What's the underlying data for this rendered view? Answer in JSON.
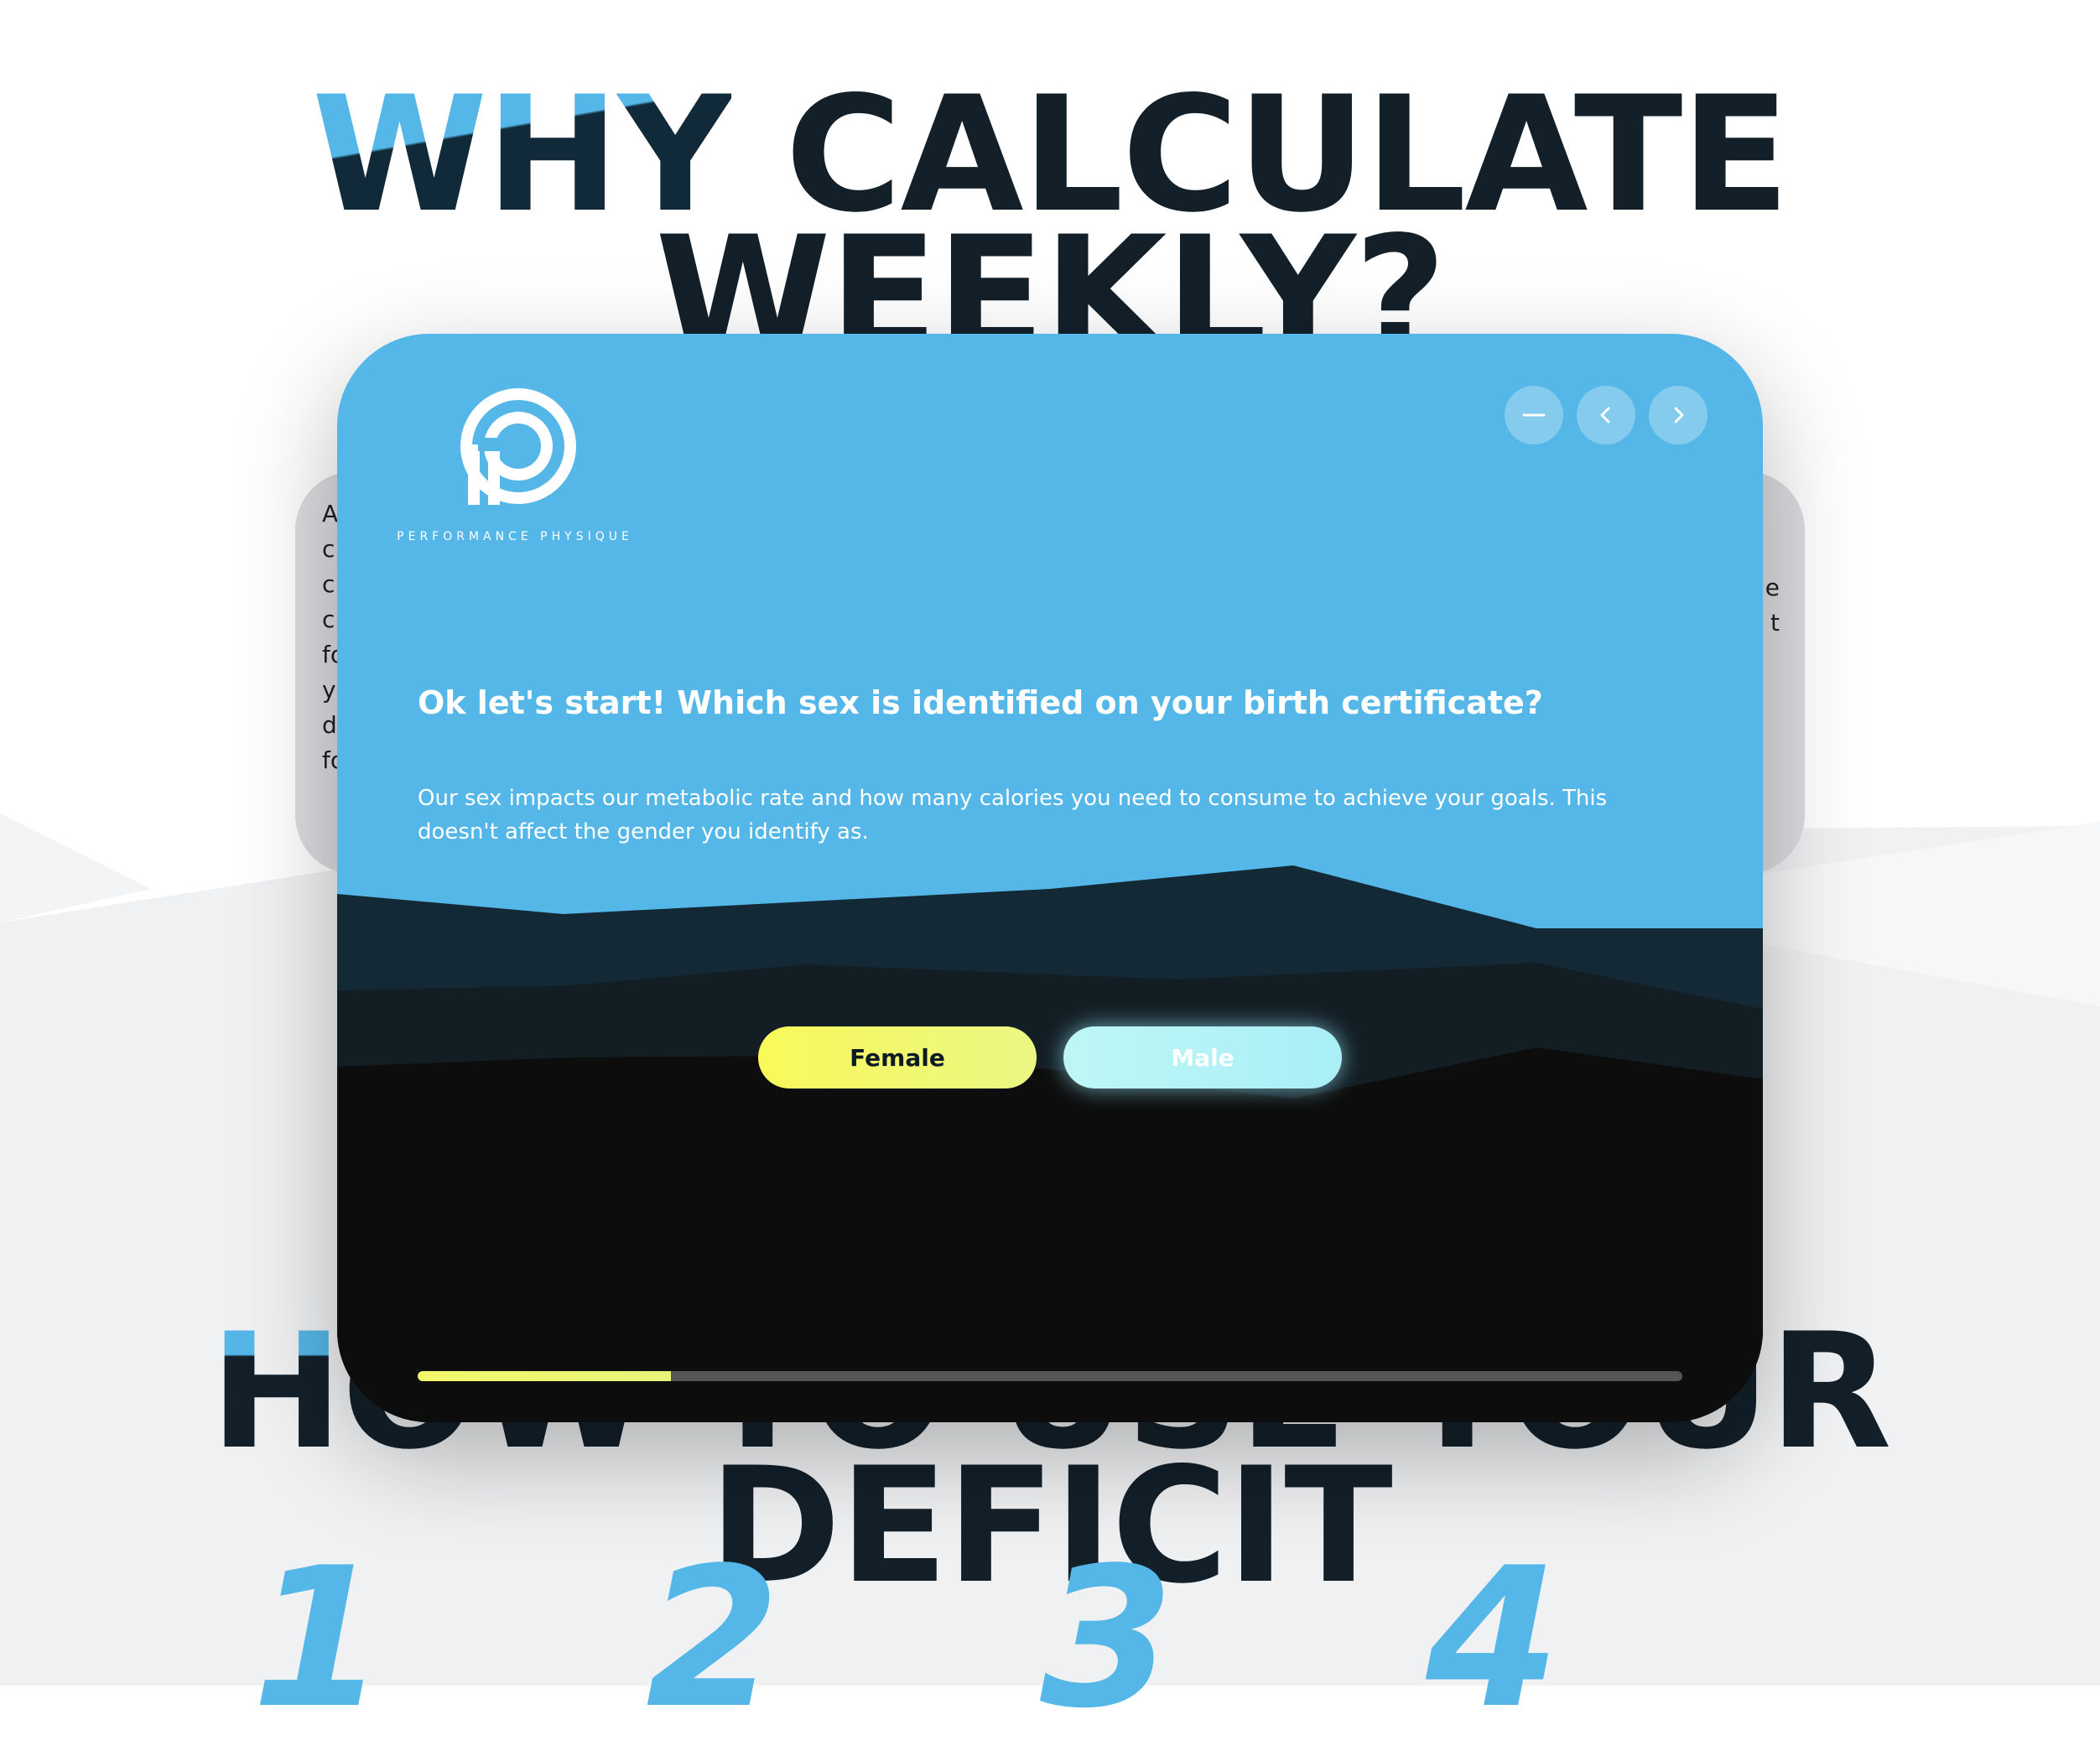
{
  "background": {
    "heading_top_word": "WHY",
    "heading_top_rest": " CALCULATE",
    "heading_top_line2": "WEEKLY?",
    "card_left_snippet": "A\nc\nc\nc\nfo\nyo\nd\nfo",
    "card_right_snippet": "e\nt",
    "heading_bottom_word": "HOW",
    "heading_bottom_rest": " TO USE YOUR",
    "heading_bottom_line2": "DEFICIT",
    "step_numbers": [
      "1",
      "2",
      "3",
      "4"
    ]
  },
  "modal": {
    "brand_name": "PERFORMANCE PHYSIQUE",
    "controls": {
      "minimize_icon": "minus-icon",
      "prev_icon": "chevron-left-icon",
      "next_icon": "chevron-right-icon"
    },
    "question": "Ok let's start! Which sex is identified on your birth certificate?",
    "explanation": "Our sex impacts our metabolic rate and how many calories you need to consume to achieve your goals. This doesn't affect the gender you identify as.",
    "options": {
      "female_label": "Female",
      "male_label": "Male"
    },
    "progress_fraction": 0.2
  },
  "colors": {
    "accent_blue": "#55b7e8",
    "heading_dark": "#13202a",
    "option_yellow": "#f9f95a",
    "option_cyan": "#bff6f6",
    "progress_fill": "#f4f86a",
    "progress_track": "#555555"
  }
}
